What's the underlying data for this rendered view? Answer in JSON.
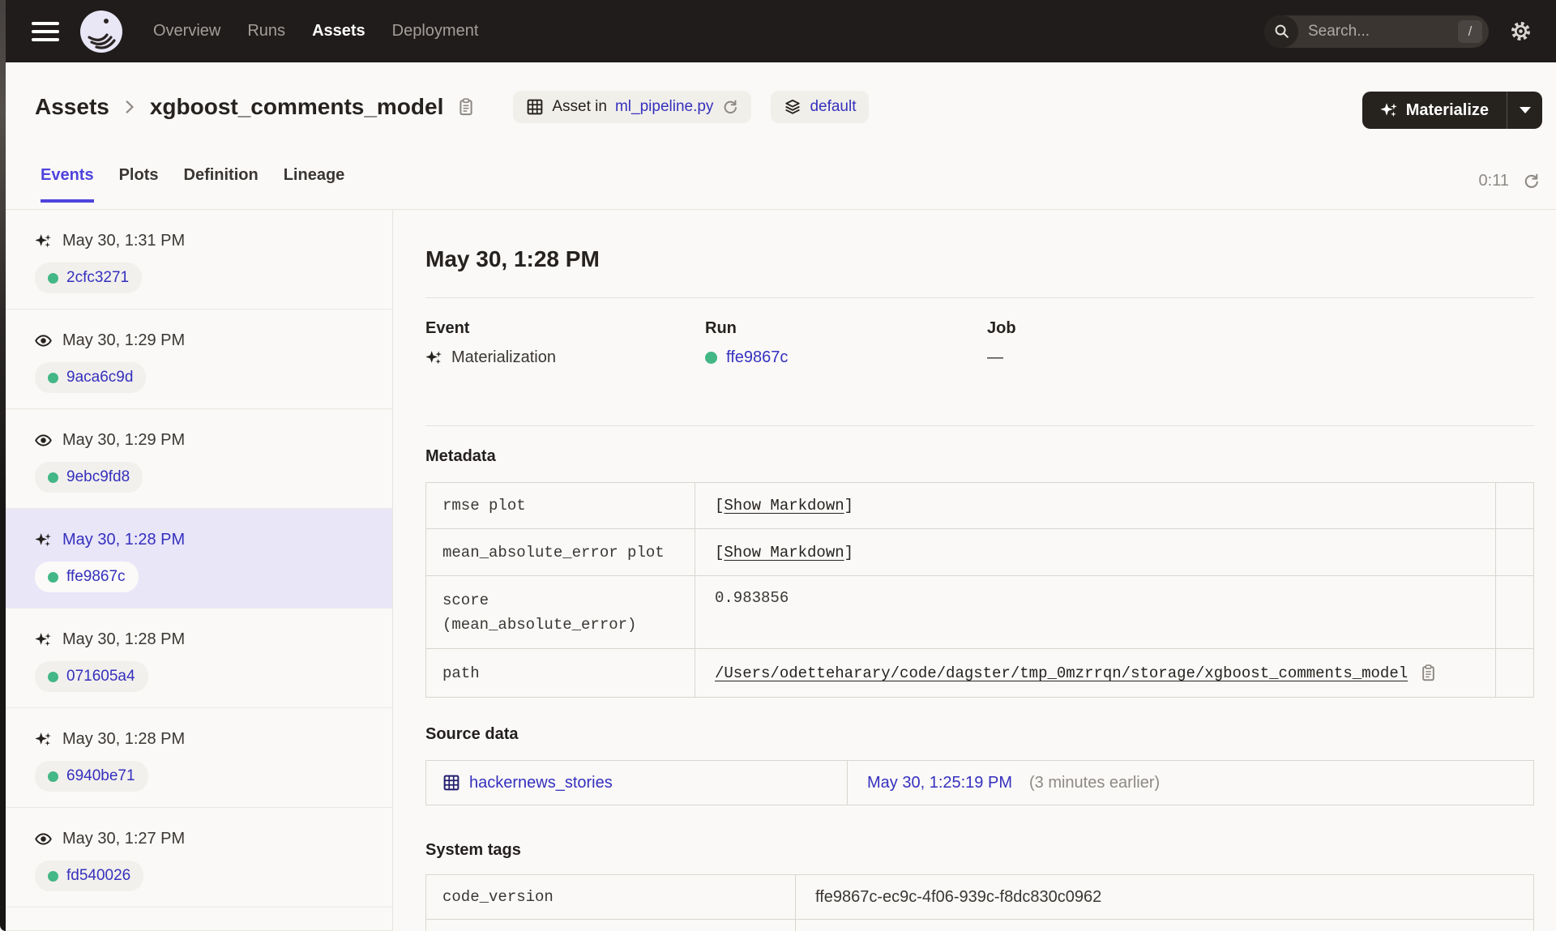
{
  "colors": {
    "accent": "#4F43DD",
    "link": "#3530BE",
    "success_green": "#43B786",
    "header_bg": "#201C1B",
    "page_bg": "#FAF9F7",
    "selected_row_bg": "#E9E6F8"
  },
  "header": {
    "nav_items": [
      "Overview",
      "Runs",
      "Assets",
      "Deployment"
    ],
    "active_nav": "Assets",
    "search": {
      "placeholder": "Search...",
      "shortcut": "/"
    }
  },
  "breadcrumb": {
    "root": "Assets",
    "current": "xgboost_comments_model"
  },
  "context": {
    "asset_in_prefix": "Asset in",
    "asset_in_link": "ml_pipeline.py",
    "group_label": "default"
  },
  "materialize": {
    "label": "Materialize"
  },
  "tabs": {
    "items": [
      "Events",
      "Plots",
      "Definition",
      "Lineage"
    ],
    "active": "Events",
    "refresh_timer": "0:11"
  },
  "sidebar": {
    "items": [
      {
        "type": "materialization",
        "timestamp": "May 30, 1:31 PM",
        "run_id": "2cfc3271",
        "selected": false
      },
      {
        "type": "observation",
        "timestamp": "May 30, 1:29 PM",
        "run_id": "9aca6c9d",
        "selected": false
      },
      {
        "type": "observation",
        "timestamp": "May 30, 1:29 PM",
        "run_id": "9ebc9fd8",
        "selected": false
      },
      {
        "type": "materialization",
        "timestamp": "May 30, 1:28 PM",
        "run_id": "ffe9867c",
        "selected": true
      },
      {
        "type": "materialization",
        "timestamp": "May 30, 1:28 PM",
        "run_id": "071605a4",
        "selected": false
      },
      {
        "type": "materialization",
        "timestamp": "May 30, 1:28 PM",
        "run_id": "6940be71",
        "selected": false
      },
      {
        "type": "observation",
        "timestamp": "May 30, 1:27 PM",
        "run_id": "fd540026",
        "selected": false
      }
    ]
  },
  "detail": {
    "title": "May 30, 1:28 PM",
    "columns": {
      "event_label": "Event",
      "event_value": "Materialization",
      "run_label": "Run",
      "run_value": "ffe9867c",
      "job_label": "Job",
      "job_value": "—"
    },
    "metadata": {
      "heading": "Metadata",
      "rows": [
        {
          "label": "rmse plot",
          "open": "[",
          "link": "Show Markdown",
          "close": "]"
        },
        {
          "label": "mean_absolute_error plot",
          "open": "[",
          "link": "Show Markdown",
          "close": "]"
        },
        {
          "label": "score (mean_absolute_error)",
          "value": "0.983856"
        },
        {
          "label": "path",
          "path": "/Users/odetteharary/code/dagster/tmp_0mzrrqn/storage/xgboost_comments_model"
        }
      ]
    },
    "source_data": {
      "heading": "Source data",
      "asset": "hackernews_stories",
      "timestamp": "May 30, 1:25:19 PM",
      "relative": "(3 minutes earlier)"
    },
    "system_tags": {
      "heading": "System tags",
      "rows": [
        {
          "key": "code_version",
          "value": "ffe9867c-ec9c-4f06-939c-f8dc830c0962"
        }
      ]
    }
  }
}
